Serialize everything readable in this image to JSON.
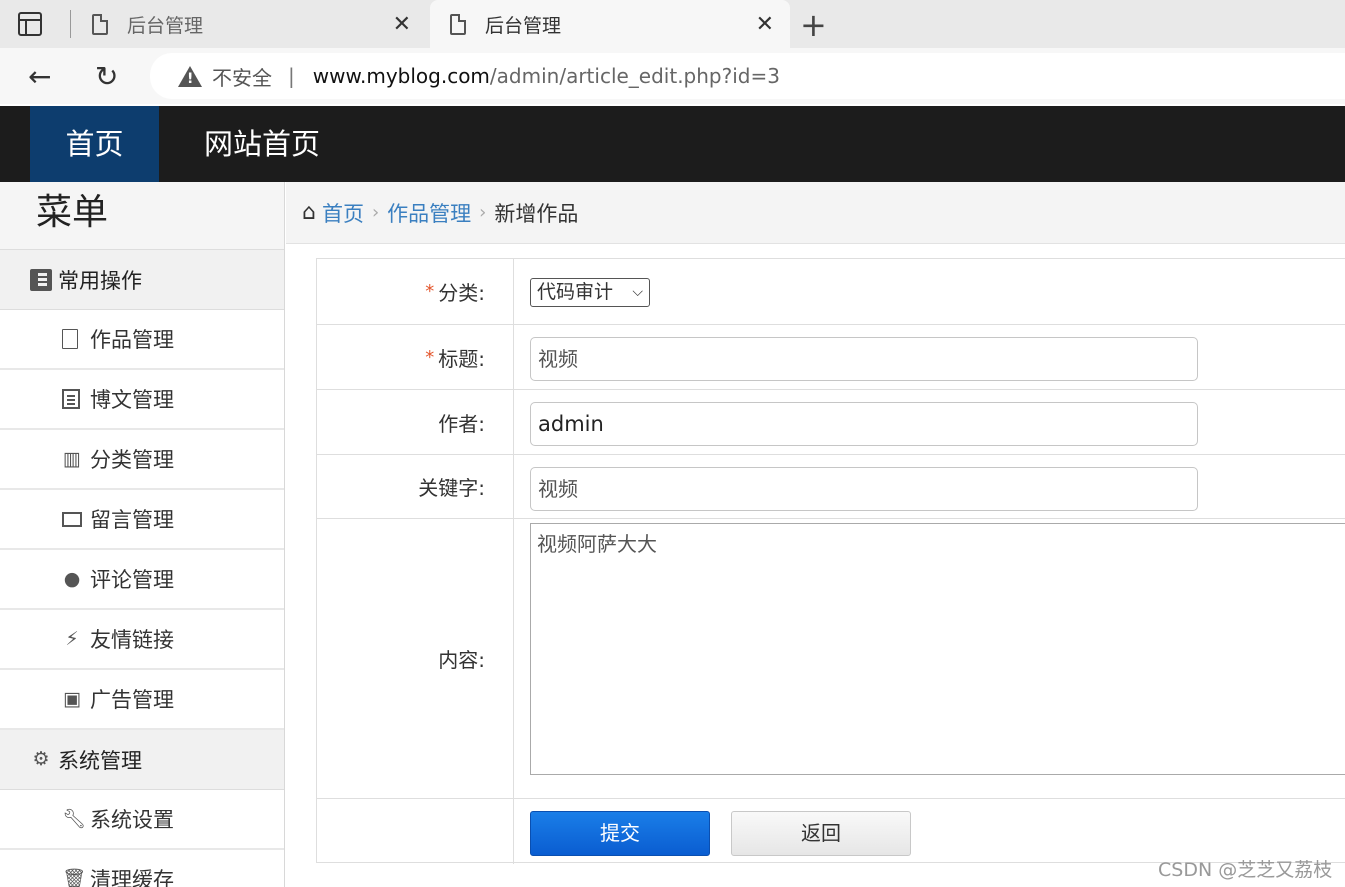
{
  "browser": {
    "tabs": [
      {
        "title": "后台管理",
        "active": false
      },
      {
        "title": "后台管理",
        "active": true
      }
    ],
    "security_label": "不安全",
    "url_host": "www.myblog.com",
    "url_path": "/admin/article_edit.php?id=3"
  },
  "header": {
    "nav": [
      {
        "label": "首页",
        "active": true
      },
      {
        "label": "网站首页",
        "active": false
      }
    ]
  },
  "sidebar": {
    "title": "菜单",
    "groups": [
      {
        "label": "常用操作",
        "icon": "contact-book-icon",
        "items": [
          {
            "label": "作品管理",
            "icon": "file-icon"
          },
          {
            "label": "博文管理",
            "icon": "list-icon"
          },
          {
            "label": "分类管理",
            "icon": "library-icon"
          },
          {
            "label": "留言管理",
            "icon": "envelope-icon"
          },
          {
            "label": "评论管理",
            "icon": "comment-icon"
          },
          {
            "label": "友情链接",
            "icon": "plug-icon"
          },
          {
            "label": "广告管理",
            "icon": "image-icon"
          }
        ]
      },
      {
        "label": "系统管理",
        "icon": "gear-icon",
        "items": [
          {
            "label": "系统设置",
            "icon": "wrench-icon"
          },
          {
            "label": "清理缓存",
            "icon": "trash-icon"
          }
        ]
      }
    ]
  },
  "breadcrumb": {
    "items": [
      "首页",
      "作品管理"
    ],
    "current": "新增作品"
  },
  "form": {
    "category": {
      "label": "分类:",
      "required": true,
      "selected": "代码审计"
    },
    "title": {
      "label": "标题:",
      "required": true,
      "value": "视频"
    },
    "author": {
      "label": "作者:",
      "value": "admin"
    },
    "keywords": {
      "label": "关键字:",
      "value": "视频"
    },
    "content": {
      "label": "内容:",
      "value": "视频阿萨大大"
    },
    "submit_label": "提交",
    "back_label": "返回"
  },
  "watermark": "CSDN @芝芝又荔枝"
}
